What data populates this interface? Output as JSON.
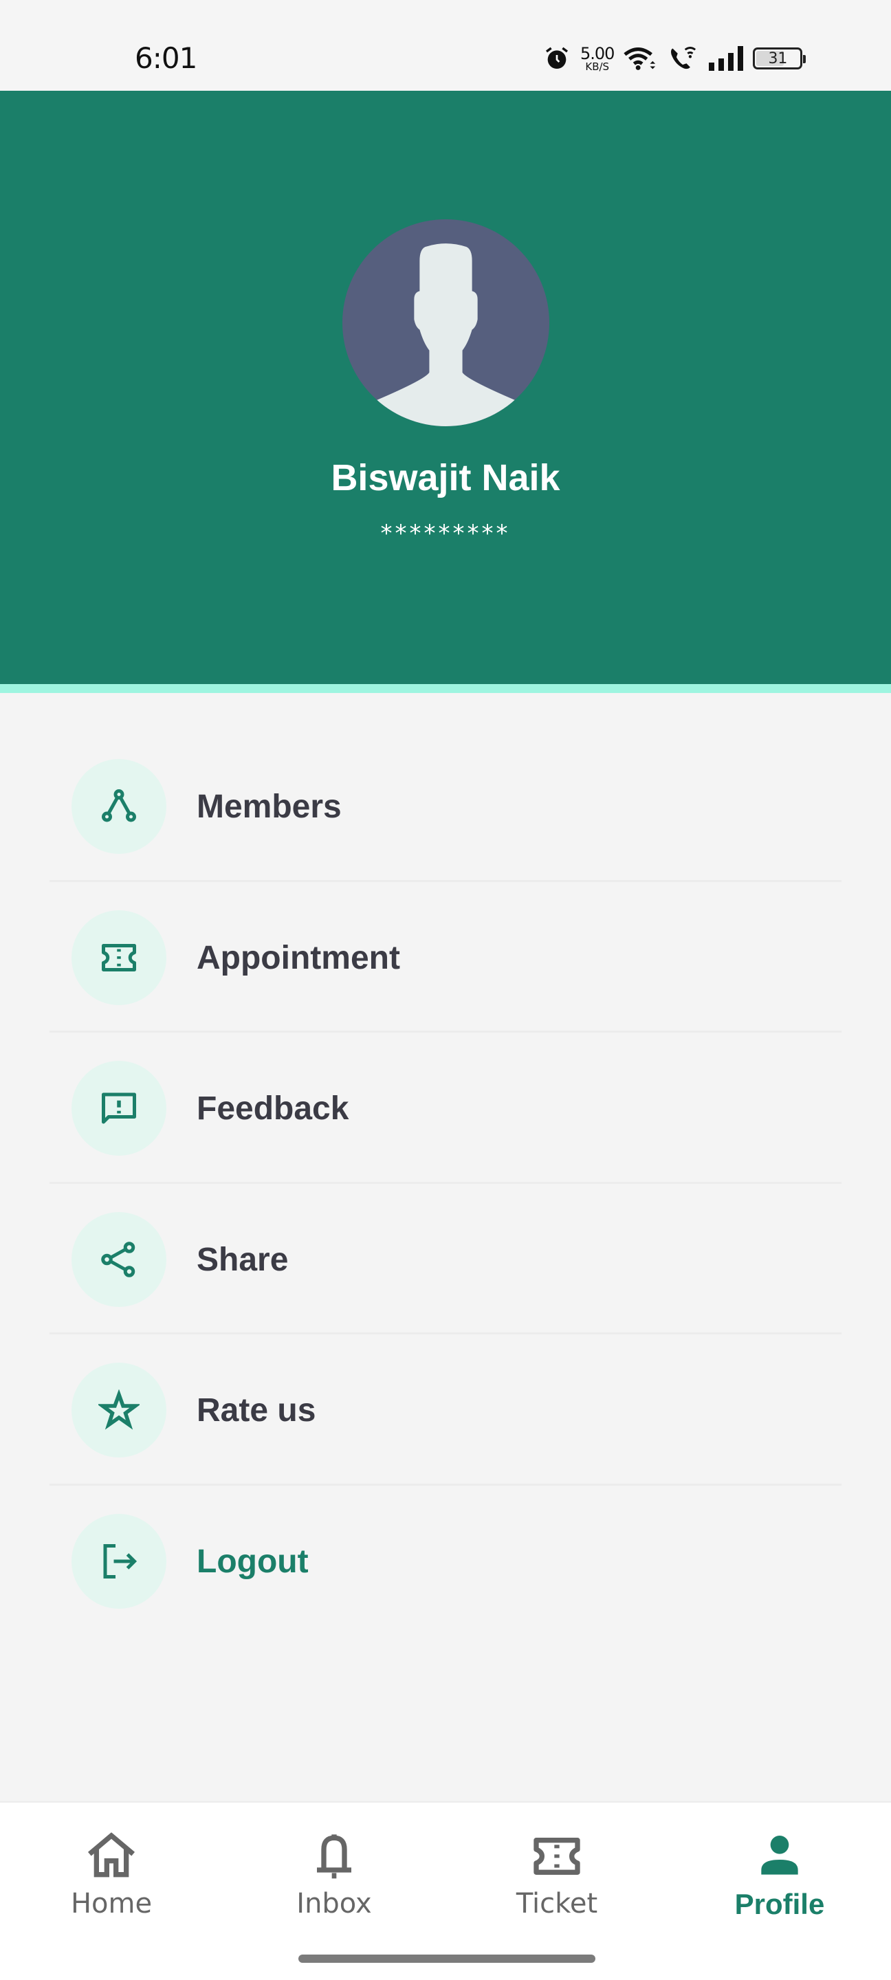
{
  "status_bar": {
    "time": "6:01",
    "net_speed_value": "5.00",
    "net_speed_unit": "KB/S",
    "battery_level": "31"
  },
  "profile": {
    "name": "Biswajit Naik",
    "masked_value": "*********"
  },
  "menu": {
    "items": [
      {
        "label": "Members",
        "icon": "members-icon"
      },
      {
        "label": "Appointment",
        "icon": "ticket-icon"
      },
      {
        "label": "Feedback",
        "icon": "feedback-icon"
      },
      {
        "label": "Share",
        "icon": "share-icon"
      },
      {
        "label": "Rate us",
        "icon": "star-icon"
      },
      {
        "label": "Logout",
        "icon": "logout-icon"
      }
    ]
  },
  "bottom_nav": {
    "items": [
      {
        "label": "Home",
        "icon": "home-icon",
        "active": false
      },
      {
        "label": "Inbox",
        "icon": "bell-icon",
        "active": false
      },
      {
        "label": "Ticket",
        "icon": "ticket-icon",
        "active": false
      },
      {
        "label": "Profile",
        "icon": "person-icon",
        "active": true
      }
    ]
  },
  "colors": {
    "primary": "#1b7f69",
    "stripe": "#9ef5e0",
    "icon_bg": "#e4f6f0",
    "avatar_bg": "#565f7e",
    "text": "#3b3b45",
    "nav_inactive": "#666666"
  }
}
